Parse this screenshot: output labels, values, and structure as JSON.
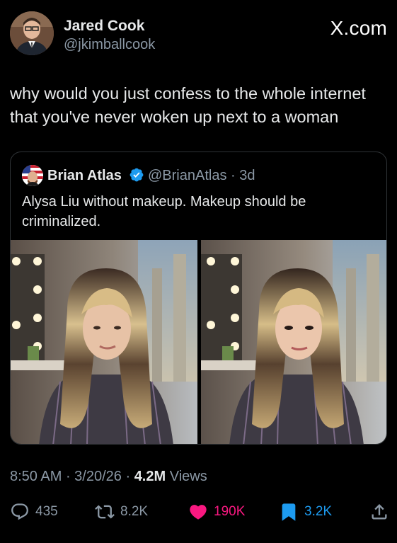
{
  "author": {
    "name": "Jared Cook",
    "handle": "@jkimballcook"
  },
  "brand": "X.com",
  "tweet": {
    "text": "why would you just confess to the whole internet that you've never woken up next to a woman"
  },
  "quoted": {
    "name": "Brian Atlas",
    "handle": "@BrianAtlas",
    "time": "3d",
    "text": "Alysa Liu without makeup. Makeup should be criminalized."
  },
  "meta": {
    "time": "8:50 AM",
    "date": "3/20/26",
    "views": "4.2M",
    "views_label": "Views"
  },
  "actions": {
    "replies": "435",
    "reposts": "8.2K",
    "likes": "190K",
    "bookmarks": "3.2K"
  },
  "colors": {
    "background": "#000000",
    "secondary_text": "#8b98a5",
    "like": "#f91880",
    "bookmark": "#1d9bf0",
    "verified": "#1d9bf0"
  },
  "icons": [
    "avatar",
    "verified-icon",
    "reply-icon",
    "repost-icon",
    "like-icon",
    "bookmark-icon",
    "share-icon"
  ]
}
